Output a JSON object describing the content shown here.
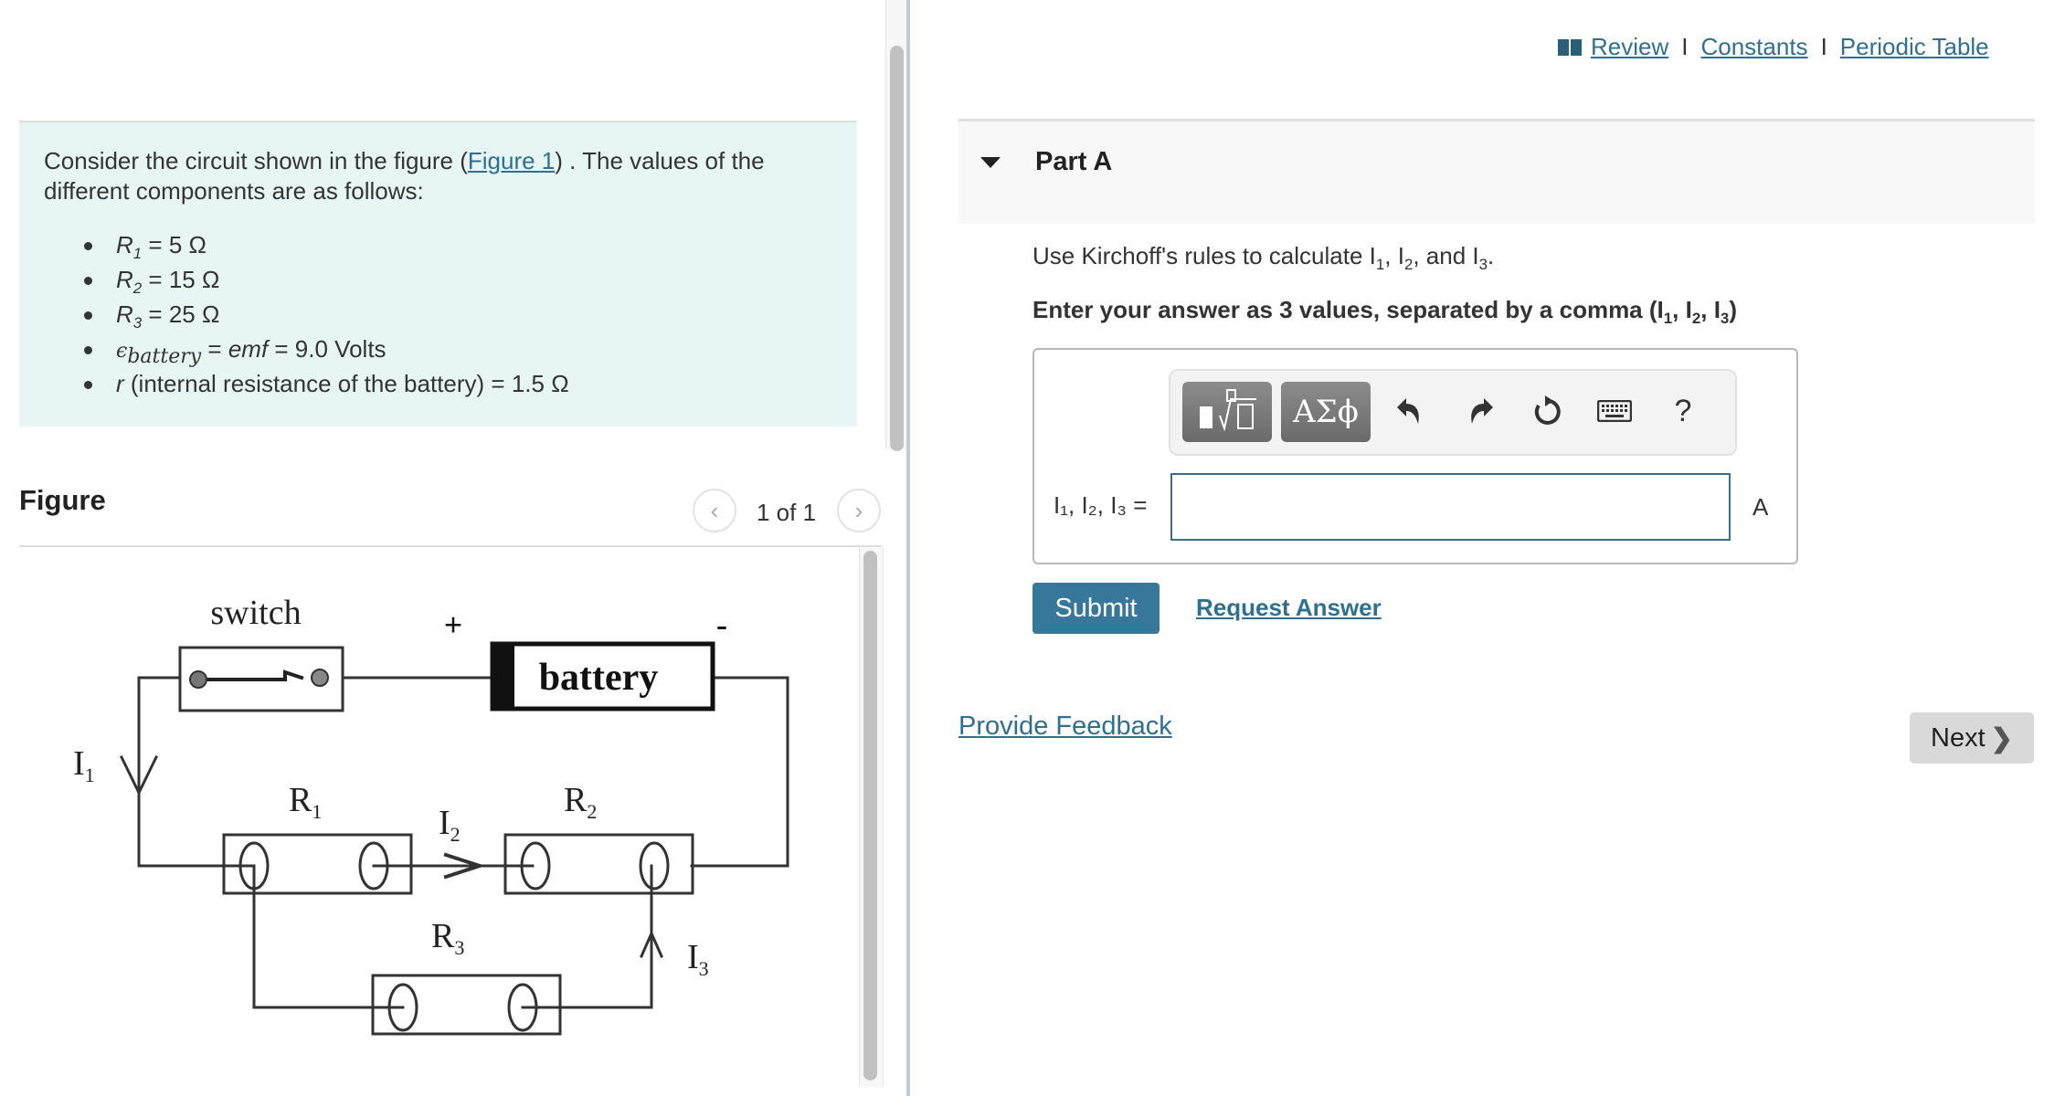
{
  "problem": {
    "intro_before_link": "Consider the circuit shown in the figure (",
    "figure_link": "Figure 1",
    "intro_after_link": ") . The values of the different components are as follows:",
    "components": [
      {
        "symbol": "R",
        "sub": "1",
        "rest": " = 5 Ω"
      },
      {
        "symbol": "R",
        "sub": "2",
        "rest": " = 15 Ω"
      },
      {
        "symbol": "R",
        "sub": "3",
        "rest": " = 25 Ω"
      }
    ],
    "emf": {
      "symbol": "ϵ",
      "sub": "battery",
      "eq1": " = ",
      "emf_word": "emf",
      "eq2": " =  9.0 Volts"
    },
    "internal": {
      "symbol": "r",
      "rest": " (internal resistance of the battery) = 1.5 Ω"
    }
  },
  "figure_panel": {
    "heading": "Figure",
    "pager_text": "1 of 1",
    "prev_icon": "chevron-left-icon",
    "next_icon": "chevron-right-icon"
  },
  "circuit": {
    "switch_label": "switch",
    "battery_label": "battery",
    "plus": "+",
    "minus": "-",
    "labels": {
      "I1": {
        "main": "I",
        "sub": "1"
      },
      "I2": {
        "main": "I",
        "sub": "2"
      },
      "I3": {
        "main": "I",
        "sub": "3"
      },
      "R1": {
        "main": "R",
        "sub": "1"
      },
      "R2": {
        "main": "R",
        "sub": "2"
      },
      "R3": {
        "main": "R",
        "sub": "3"
      }
    }
  },
  "top_links": {
    "review": "Review",
    "separator": "I",
    "constants": "Constants",
    "periodic_table": "Periodic Table"
  },
  "partA": {
    "title": "Part A",
    "instruction_pre": "Use Kirchoff's rules to calculate I",
    "instruction_bold": "Enter your answer as 3 values, separated by a comma (I",
    "answer_label": "I₁, I₂, I₃ =",
    "answer_value": "",
    "unit": "A",
    "toolbar": {
      "templates_icon": "templates-icon",
      "greek_label": "ΑΣϕ",
      "undo_icon": "undo-icon",
      "redo_icon": "redo-icon",
      "reset_icon": "reset-icon",
      "keyboard_icon": "keyboard-icon",
      "help_label": "?"
    },
    "submit": "Submit",
    "request_answer": "Request Answer"
  },
  "feedback": "Provide Feedback",
  "next": {
    "label": "Next",
    "chevron": "❯"
  },
  "colors": {
    "link": "#2f6f8f",
    "submit_bg": "#37789a",
    "intro_bg": "#e8f5f5"
  }
}
